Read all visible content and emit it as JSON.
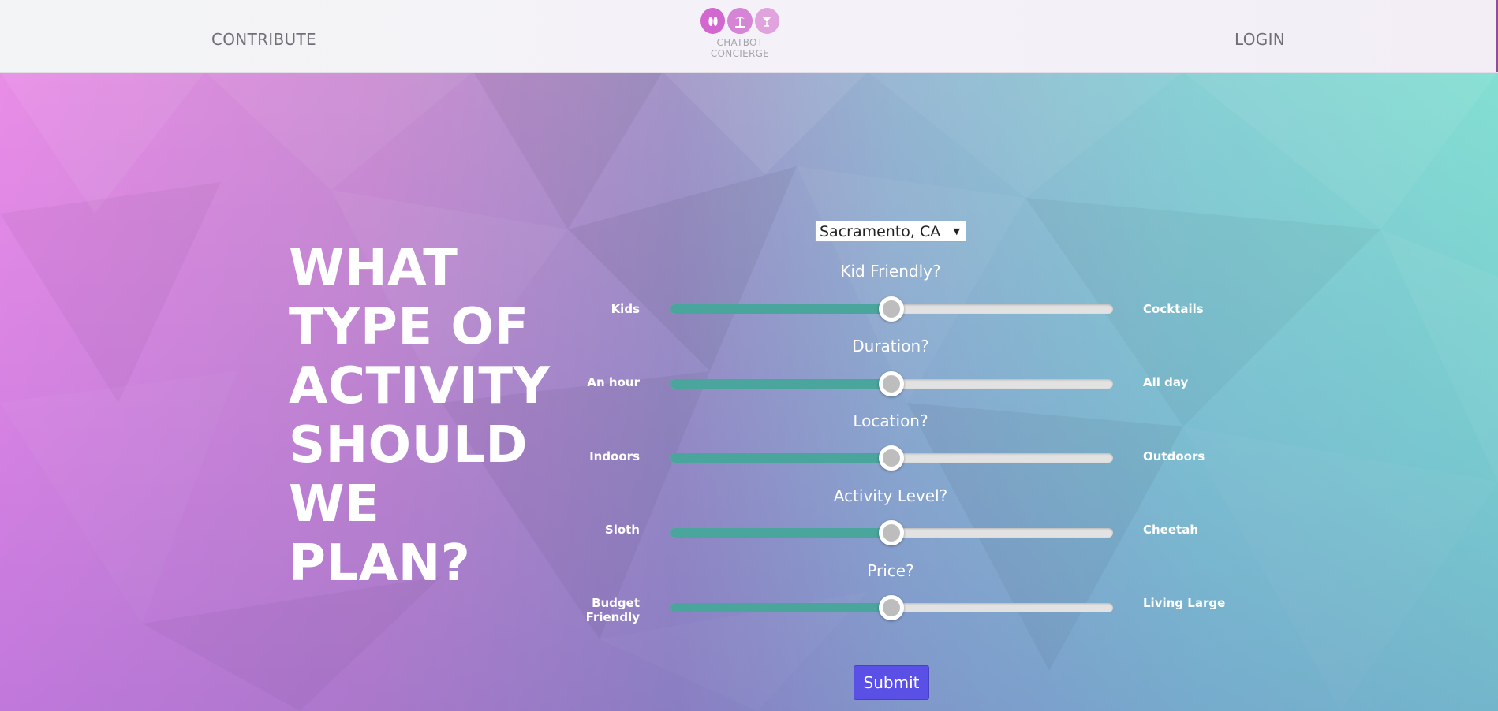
{
  "nav": {
    "contribute_label": "CONTRIBUTE",
    "login_label": "LOGIN",
    "logo_line1": "CHATBOT",
    "logo_line2": "CONCIERGE",
    "logo_icons": [
      "flip-flops-icon",
      "palm-tree-icon",
      "cocktail-icon"
    ]
  },
  "hero": {
    "headline": [
      "WHAT",
      "TYPE OF",
      "ACTIVITY",
      "SHOULD",
      "WE",
      "PLAN?"
    ]
  },
  "form": {
    "city_value": "Sacramento, CA",
    "sliders": [
      {
        "question": "Kid Friendly?",
        "left_label": "Kids",
        "right_label": "Cocktails",
        "value": 0.5
      },
      {
        "question": "Duration?",
        "left_label": "An hour",
        "right_label": "All day",
        "value": 0.5
      },
      {
        "question": "Location?",
        "left_label": "Indoors",
        "right_label": "Outdoors",
        "value": 0.5
      },
      {
        "question": "Activity Level?",
        "left_label": "Sloth",
        "right_label": "Cheetah",
        "value": 0.5
      },
      {
        "question": "Price?",
        "left_label": "Budget Friendly",
        "right_label": "Living Large",
        "value": 0.5
      }
    ],
    "submit_label": "Submit"
  },
  "colors": {
    "accent_teal": "#4aa59c",
    "submit_purple": "#5a50e6",
    "logo_pink": "#d167cf"
  }
}
